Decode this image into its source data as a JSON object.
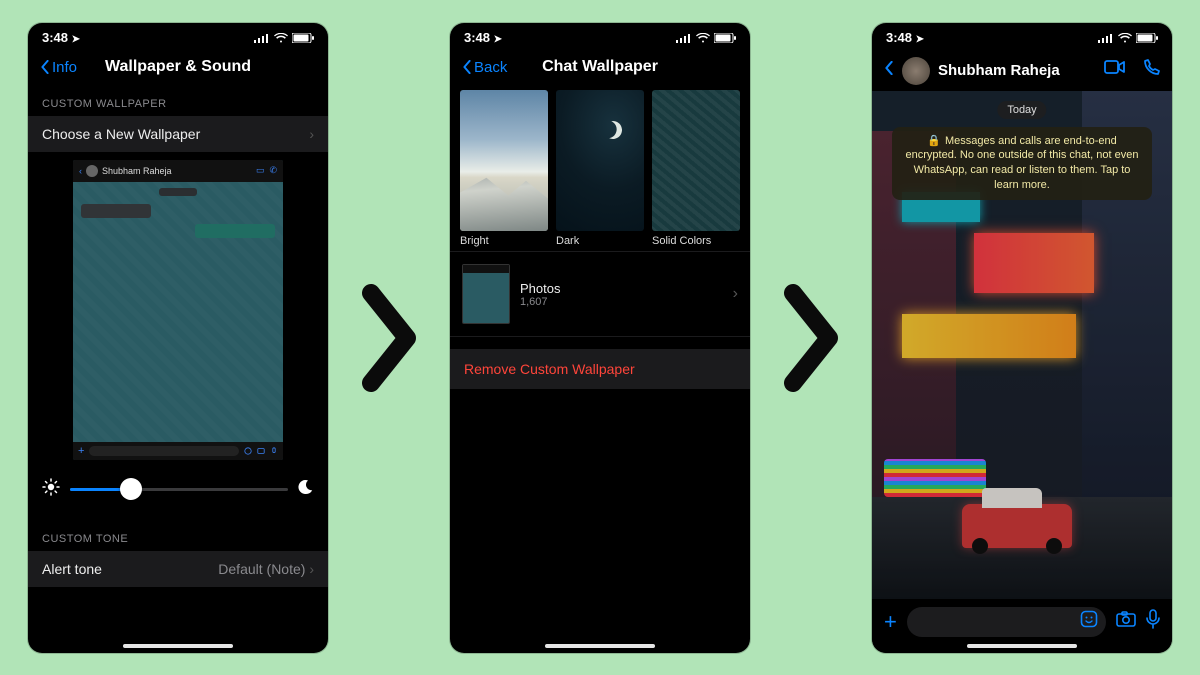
{
  "status": {
    "time": "3:48",
    "location_arrow": "➤"
  },
  "arrows": {
    "glyph": "›"
  },
  "screen1": {
    "back_label": "Info",
    "title": "Wallpaper & Sound",
    "section_wallpaper": "CUSTOM WALLPAPER",
    "choose": "Choose a New Wallpaper",
    "preview_name": "Shubham Raheja",
    "section_tone": "CUSTOM TONE",
    "alert_tone": "Alert tone",
    "alert_value": "Default (Note)"
  },
  "screen2": {
    "back_label": "Back",
    "title": "Chat Wallpaper",
    "categories": [
      "Bright",
      "Dark",
      "Solid Colors"
    ],
    "photos_label": "Photos",
    "photos_count": "1,607",
    "remove": "Remove Custom Wallpaper"
  },
  "screen3": {
    "contact": "Shubham Raheja",
    "today": "Today",
    "e2e": "Messages and calls are end-to-end encrypted. No one outside of this chat, not even WhatsApp, can read or listen to them. Tap to learn more."
  }
}
